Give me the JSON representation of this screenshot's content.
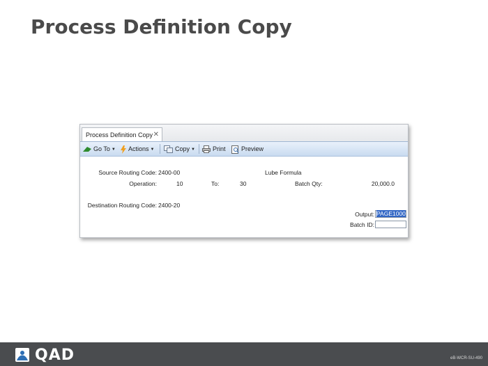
{
  "slide": {
    "title": "Process Definition Copy"
  },
  "window": {
    "tab_label": "Process Definition Copy",
    "tab_close": "✕",
    "toolbar": {
      "goto": "Go To",
      "actions": "Actions",
      "copy": "Copy",
      "print": "Print",
      "preview": "Preview"
    }
  },
  "form": {
    "source_label": "Source Routing Code:",
    "source_value": "2400-00",
    "description": "Lube Formula",
    "operation_label": "Operation:",
    "operation_value": "10",
    "to_label": "To:",
    "to_value": "30",
    "batch_qty_label": "Batch Qty:",
    "batch_qty_value": "20,000.0",
    "dest_label": "Destination Routing Code:",
    "dest_value": "2400-20",
    "output_label": "Output:",
    "output_value": "PAGE1000",
    "batch_id_label": "Batch ID:",
    "batch_id_value": ""
  },
  "footer": {
    "logo": "QAD",
    "code": "eB-WCR-SU-490"
  },
  "colors": {
    "footer_bg": "#4a4c4f",
    "selection": "#3166c5",
    "toolbar": "#c9dbf0"
  }
}
